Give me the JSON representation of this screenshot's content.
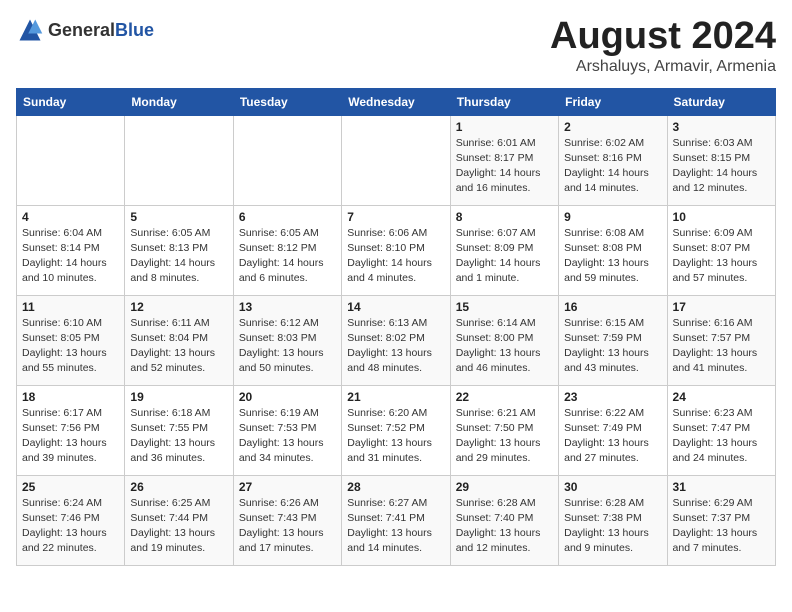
{
  "header": {
    "logo_general": "General",
    "logo_blue": "Blue",
    "month_year": "August 2024",
    "subtitle": "Arshaluys, Armavir, Armenia"
  },
  "days_of_week": [
    "Sunday",
    "Monday",
    "Tuesday",
    "Wednesday",
    "Thursday",
    "Friday",
    "Saturday"
  ],
  "weeks": [
    [
      {
        "day": "",
        "text": ""
      },
      {
        "day": "",
        "text": ""
      },
      {
        "day": "",
        "text": ""
      },
      {
        "day": "",
        "text": ""
      },
      {
        "day": "1",
        "text": "Sunrise: 6:01 AM\nSunset: 8:17 PM\nDaylight: 14 hours\nand 16 minutes."
      },
      {
        "day": "2",
        "text": "Sunrise: 6:02 AM\nSunset: 8:16 PM\nDaylight: 14 hours\nand 14 minutes."
      },
      {
        "day": "3",
        "text": "Sunrise: 6:03 AM\nSunset: 8:15 PM\nDaylight: 14 hours\nand 12 minutes."
      }
    ],
    [
      {
        "day": "4",
        "text": "Sunrise: 6:04 AM\nSunset: 8:14 PM\nDaylight: 14 hours\nand 10 minutes."
      },
      {
        "day": "5",
        "text": "Sunrise: 6:05 AM\nSunset: 8:13 PM\nDaylight: 14 hours\nand 8 minutes."
      },
      {
        "day": "6",
        "text": "Sunrise: 6:05 AM\nSunset: 8:12 PM\nDaylight: 14 hours\nand 6 minutes."
      },
      {
        "day": "7",
        "text": "Sunrise: 6:06 AM\nSunset: 8:10 PM\nDaylight: 14 hours\nand 4 minutes."
      },
      {
        "day": "8",
        "text": "Sunrise: 6:07 AM\nSunset: 8:09 PM\nDaylight: 14 hours\nand 1 minute."
      },
      {
        "day": "9",
        "text": "Sunrise: 6:08 AM\nSunset: 8:08 PM\nDaylight: 13 hours\nand 59 minutes."
      },
      {
        "day": "10",
        "text": "Sunrise: 6:09 AM\nSunset: 8:07 PM\nDaylight: 13 hours\nand 57 minutes."
      }
    ],
    [
      {
        "day": "11",
        "text": "Sunrise: 6:10 AM\nSunset: 8:05 PM\nDaylight: 13 hours\nand 55 minutes."
      },
      {
        "day": "12",
        "text": "Sunrise: 6:11 AM\nSunset: 8:04 PM\nDaylight: 13 hours\nand 52 minutes."
      },
      {
        "day": "13",
        "text": "Sunrise: 6:12 AM\nSunset: 8:03 PM\nDaylight: 13 hours\nand 50 minutes."
      },
      {
        "day": "14",
        "text": "Sunrise: 6:13 AM\nSunset: 8:02 PM\nDaylight: 13 hours\nand 48 minutes."
      },
      {
        "day": "15",
        "text": "Sunrise: 6:14 AM\nSunset: 8:00 PM\nDaylight: 13 hours\nand 46 minutes."
      },
      {
        "day": "16",
        "text": "Sunrise: 6:15 AM\nSunset: 7:59 PM\nDaylight: 13 hours\nand 43 minutes."
      },
      {
        "day": "17",
        "text": "Sunrise: 6:16 AM\nSunset: 7:57 PM\nDaylight: 13 hours\nand 41 minutes."
      }
    ],
    [
      {
        "day": "18",
        "text": "Sunrise: 6:17 AM\nSunset: 7:56 PM\nDaylight: 13 hours\nand 39 minutes."
      },
      {
        "day": "19",
        "text": "Sunrise: 6:18 AM\nSunset: 7:55 PM\nDaylight: 13 hours\nand 36 minutes."
      },
      {
        "day": "20",
        "text": "Sunrise: 6:19 AM\nSunset: 7:53 PM\nDaylight: 13 hours\nand 34 minutes."
      },
      {
        "day": "21",
        "text": "Sunrise: 6:20 AM\nSunset: 7:52 PM\nDaylight: 13 hours\nand 31 minutes."
      },
      {
        "day": "22",
        "text": "Sunrise: 6:21 AM\nSunset: 7:50 PM\nDaylight: 13 hours\nand 29 minutes."
      },
      {
        "day": "23",
        "text": "Sunrise: 6:22 AM\nSunset: 7:49 PM\nDaylight: 13 hours\nand 27 minutes."
      },
      {
        "day": "24",
        "text": "Sunrise: 6:23 AM\nSunset: 7:47 PM\nDaylight: 13 hours\nand 24 minutes."
      }
    ],
    [
      {
        "day": "25",
        "text": "Sunrise: 6:24 AM\nSunset: 7:46 PM\nDaylight: 13 hours\nand 22 minutes."
      },
      {
        "day": "26",
        "text": "Sunrise: 6:25 AM\nSunset: 7:44 PM\nDaylight: 13 hours\nand 19 minutes."
      },
      {
        "day": "27",
        "text": "Sunrise: 6:26 AM\nSunset: 7:43 PM\nDaylight: 13 hours\nand 17 minutes."
      },
      {
        "day": "28",
        "text": "Sunrise: 6:27 AM\nSunset: 7:41 PM\nDaylight: 13 hours\nand 14 minutes."
      },
      {
        "day": "29",
        "text": "Sunrise: 6:28 AM\nSunset: 7:40 PM\nDaylight: 13 hours\nand 12 minutes."
      },
      {
        "day": "30",
        "text": "Sunrise: 6:28 AM\nSunset: 7:38 PM\nDaylight: 13 hours\nand 9 minutes."
      },
      {
        "day": "31",
        "text": "Sunrise: 6:29 AM\nSunset: 7:37 PM\nDaylight: 13 hours\nand 7 minutes."
      }
    ]
  ]
}
